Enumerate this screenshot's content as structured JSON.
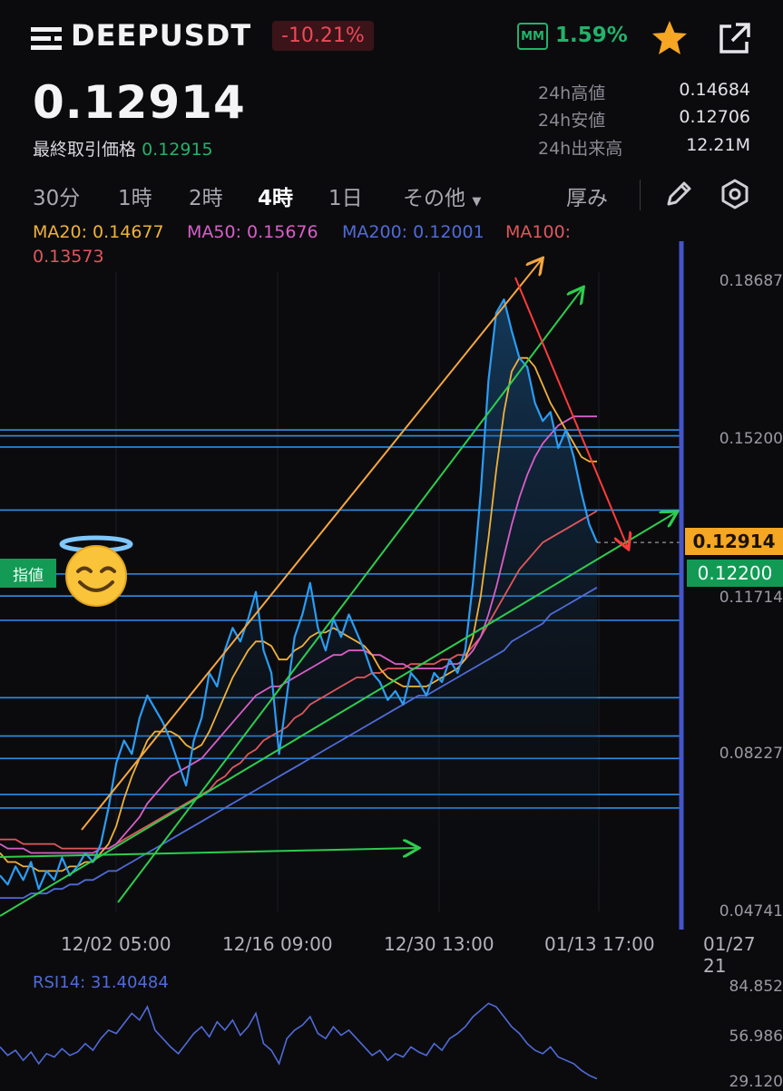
{
  "header": {
    "symbol": "DEEPUSDT",
    "change_pct": "-10.21%",
    "mm_badge": "MM",
    "mm_value": "1.59%",
    "icons": [
      "menu-icon",
      "star-icon",
      "share-icon"
    ]
  },
  "price": {
    "current": "0.12914",
    "last_label": "最終取引価格",
    "last_value": "0.12915"
  },
  "stats": [
    {
      "label": "24h高値",
      "value": "0.14684"
    },
    {
      "label": "24h安値",
      "value": "0.12706"
    },
    {
      "label": "24h出来高",
      "value": "12.21M"
    }
  ],
  "timeframes": [
    {
      "label": "30分",
      "active": false
    },
    {
      "label": "1時",
      "active": false
    },
    {
      "label": "2時",
      "active": false
    },
    {
      "label": "4時",
      "active": true
    },
    {
      "label": "1日",
      "active": false
    },
    {
      "label": "その他",
      "active": false
    }
  ],
  "toolbar": {
    "depth_label": "厚み",
    "icons": [
      "pencil-icon",
      "gear-icon"
    ]
  },
  "ma_legend": [
    {
      "text": "MA20: 0.14677",
      "color": "#f0b13a"
    },
    {
      "text": "MA50: 0.15676",
      "color": "#d95ec8"
    },
    {
      "text": "MA200: 0.12001",
      "color": "#4f6bd8"
    },
    {
      "text": "MA100:",
      "color": "#e0575b"
    },
    {
      "text": "0.13573",
      "color": "#e0575b"
    }
  ],
  "colors": {
    "up": "#21b36b",
    "down": "#f0475a",
    "price_line": "#1e90ff",
    "accent": "#f5a623"
  },
  "chart_data": {
    "type": "line",
    "symbol": "DEEPUSDT",
    "interval": "4時",
    "x_ticks": [
      "12/02 05:00",
      "12/16 09:00",
      "12/30 13:00",
      "01/13 17:00",
      "01/27 21"
    ],
    "y_ticks": [
      "0.18687",
      "0.15200",
      "0.11714",
      "0.08227",
      "0.04741"
    ],
    "ylim": [
      0.04741,
      0.18687
    ],
    "price_series": [
      0.055,
      0.053,
      0.057,
      0.054,
      0.058,
      0.052,
      0.056,
      0.054,
      0.059,
      0.055,
      0.057,
      0.06,
      0.058,
      0.062,
      0.07,
      0.08,
      0.085,
      0.082,
      0.09,
      0.095,
      0.092,
      0.089,
      0.085,
      0.08,
      0.075,
      0.085,
      0.09,
      0.1,
      0.097,
      0.105,
      0.11,
      0.107,
      0.112,
      0.118,
      0.105,
      0.1,
      0.082,
      0.095,
      0.108,
      0.113,
      0.12,
      0.11,
      0.105,
      0.112,
      0.108,
      0.113,
      0.109,
      0.105,
      0.1,
      0.098,
      0.094,
      0.096,
      0.093,
      0.1,
      0.098,
      0.095,
      0.1,
      0.098,
      0.103,
      0.1,
      0.105,
      0.12,
      0.14,
      0.165,
      0.18,
      0.183,
      0.176,
      0.17,
      0.168,
      0.16,
      0.156,
      0.158,
      0.15,
      0.154,
      0.148,
      0.14,
      0.133,
      0.129
    ],
    "ma20": [
      0.06,
      0.058,
      0.058,
      0.057,
      0.057,
      0.056,
      0.056,
      0.056,
      0.056,
      0.057,
      0.057,
      0.058,
      0.058,
      0.06,
      0.062,
      0.066,
      0.072,
      0.077,
      0.081,
      0.085,
      0.087,
      0.087,
      0.087,
      0.086,
      0.084,
      0.083,
      0.084,
      0.087,
      0.091,
      0.095,
      0.099,
      0.102,
      0.105,
      0.107,
      0.107,
      0.106,
      0.103,
      0.103,
      0.105,
      0.106,
      0.108,
      0.109,
      0.109,
      0.11,
      0.109,
      0.108,
      0.107,
      0.106,
      0.104,
      0.101,
      0.099,
      0.098,
      0.097,
      0.097,
      0.097,
      0.097,
      0.098,
      0.099,
      0.1,
      0.101,
      0.103,
      0.108,
      0.117,
      0.13,
      0.145,
      0.158,
      0.167,
      0.17,
      0.17,
      0.168,
      0.164,
      0.16,
      0.157,
      0.154,
      0.151,
      0.148,
      0.147,
      0.147
    ],
    "ma50": [
      0.062,
      0.061,
      0.061,
      0.061,
      0.06,
      0.06,
      0.06,
      0.06,
      0.06,
      0.06,
      0.06,
      0.06,
      0.06,
      0.061,
      0.061,
      0.062,
      0.064,
      0.066,
      0.068,
      0.071,
      0.073,
      0.075,
      0.077,
      0.078,
      0.079,
      0.08,
      0.081,
      0.083,
      0.085,
      0.087,
      0.089,
      0.091,
      0.093,
      0.095,
      0.096,
      0.097,
      0.097,
      0.098,
      0.099,
      0.1,
      0.101,
      0.102,
      0.103,
      0.104,
      0.104,
      0.105,
      0.105,
      0.105,
      0.104,
      0.104,
      0.103,
      0.102,
      0.102,
      0.101,
      0.101,
      0.101,
      0.101,
      0.101,
      0.102,
      0.102,
      0.103,
      0.105,
      0.108,
      0.113,
      0.119,
      0.126,
      0.133,
      0.139,
      0.144,
      0.148,
      0.151,
      0.153,
      0.155,
      0.156,
      0.157,
      0.157,
      0.157,
      0.157
    ],
    "ma100": [
      0.063,
      0.063,
      0.063,
      0.062,
      0.062,
      0.062,
      0.062,
      0.062,
      0.061,
      0.061,
      0.061,
      0.061,
      0.061,
      0.061,
      0.061,
      0.062,
      0.063,
      0.064,
      0.065,
      0.066,
      0.067,
      0.068,
      0.069,
      0.07,
      0.071,
      0.072,
      0.073,
      0.074,
      0.076,
      0.077,
      0.079,
      0.08,
      0.082,
      0.083,
      0.085,
      0.086,
      0.087,
      0.088,
      0.09,
      0.091,
      0.093,
      0.094,
      0.095,
      0.096,
      0.097,
      0.098,
      0.099,
      0.099,
      0.1,
      0.1,
      0.101,
      0.101,
      0.101,
      0.102,
      0.102,
      0.102,
      0.102,
      0.103,
      0.103,
      0.104,
      0.104,
      0.106,
      0.108,
      0.111,
      0.114,
      0.117,
      0.12,
      0.123,
      0.125,
      0.127,
      0.129,
      0.13,
      0.131,
      0.132,
      0.133,
      0.134,
      0.135,
      0.136
    ],
    "ma200": [
      0.05,
      0.05,
      0.05,
      0.05,
      0.051,
      0.051,
      0.051,
      0.052,
      0.052,
      0.053,
      0.053,
      0.054,
      0.054,
      0.055,
      0.056,
      0.056,
      0.057,
      0.058,
      0.059,
      0.06,
      0.061,
      0.062,
      0.063,
      0.064,
      0.065,
      0.066,
      0.067,
      0.068,
      0.069,
      0.07,
      0.071,
      0.072,
      0.073,
      0.074,
      0.075,
      0.076,
      0.077,
      0.078,
      0.079,
      0.08,
      0.081,
      0.082,
      0.083,
      0.084,
      0.085,
      0.086,
      0.087,
      0.088,
      0.089,
      0.09,
      0.091,
      0.092,
      0.093,
      0.094,
      0.095,
      0.095,
      0.096,
      0.097,
      0.098,
      0.099,
      0.1,
      0.101,
      0.102,
      0.103,
      0.104,
      0.105,
      0.107,
      0.108,
      0.109,
      0.11,
      0.111,
      0.113,
      0.114,
      0.115,
      0.116,
      0.117,
      0.118,
      0.119
    ],
    "horizontal_levels": [
      0.154,
      0.1527,
      0.1502,
      0.1362,
      0.122,
      0.1171,
      0.1117,
      0.0945,
      0.086,
      0.081,
      0.073,
      0.07
    ],
    "price_label": "0.12914",
    "order_label": "0.12200",
    "limit_tag": "指値",
    "rsi": {
      "label": "RSI14: 31.40484",
      "y_ticks": [
        "84.852",
        "56.986",
        "29.120"
      ],
      "ylim": [
        29.12,
        84.852
      ],
      "values": [
        50,
        45,
        48,
        42,
        47,
        40,
        46,
        44,
        49,
        45,
        47,
        52,
        48,
        55,
        60,
        58,
        64,
        70,
        66,
        74,
        60,
        55,
        50,
        46,
        52,
        58,
        62,
        56,
        65,
        60,
        66,
        57,
        62,
        70,
        52,
        48,
        40,
        55,
        60,
        63,
        68,
        58,
        55,
        62,
        57,
        60,
        55,
        50,
        45,
        48,
        42,
        46,
        44,
        50,
        47,
        45,
        52,
        48,
        55,
        58,
        62,
        68,
        72,
        76,
        74,
        68,
        62,
        58,
        52,
        48,
        46,
        50,
        44,
        42,
        40,
        36,
        33,
        31
      ]
    }
  }
}
